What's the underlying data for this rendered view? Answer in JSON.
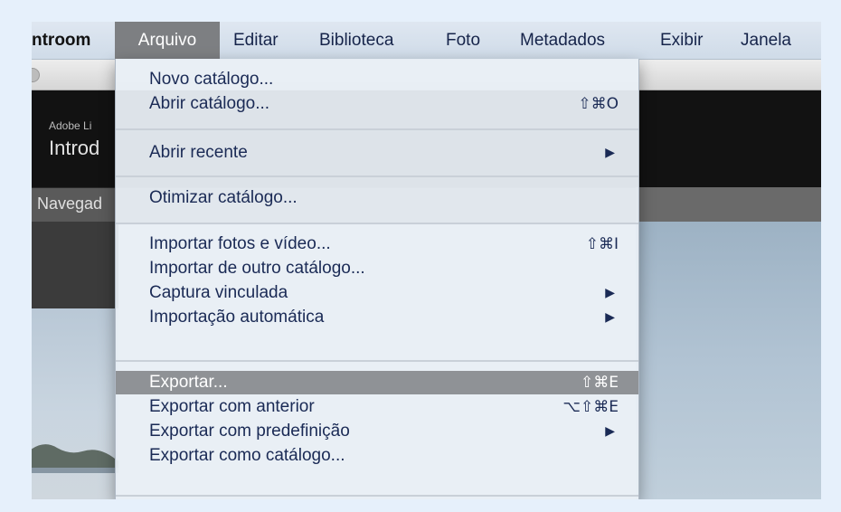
{
  "menubar": {
    "app_name": "ntroom",
    "items": [
      "Arquivo",
      "Editar",
      "Biblioteca",
      "Foto",
      "Metadados",
      "Exibir",
      "Janela"
    ]
  },
  "window": {
    "brand": "Adobe Li",
    "catalog_title": "Introd",
    "navigator_label": "Navegad"
  },
  "menu": {
    "items": [
      {
        "label": "Novo catálogo..."
      },
      {
        "label": "Abrir catálogo...",
        "shortcut": "⇧⌘O"
      },
      {
        "label": "Abrir recente",
        "submenu": "▶"
      },
      {
        "label": "Otimizar catálogo..."
      },
      {
        "label": "Importar fotos e vídeo...",
        "shortcut": "⇧⌘I"
      },
      {
        "label": "Importar de outro catálogo..."
      },
      {
        "label": "Captura vinculada",
        "submenu": "▶"
      },
      {
        "label": "Importação automática",
        "submenu": "▶"
      },
      {
        "label": "Exportar...",
        "shortcut": "⇧⌘E"
      },
      {
        "label": "Exportar com anterior",
        "shortcut": "⌥⇧⌘E"
      },
      {
        "label": "Exportar com predefinição",
        "submenu": "▶"
      },
      {
        "label": "Exportar como catálogo..."
      }
    ]
  },
  "colors": {
    "menu_highlight": "#8f9296",
    "menu_text": "#1a2a55",
    "active_menu_title": "#7d7f82"
  }
}
